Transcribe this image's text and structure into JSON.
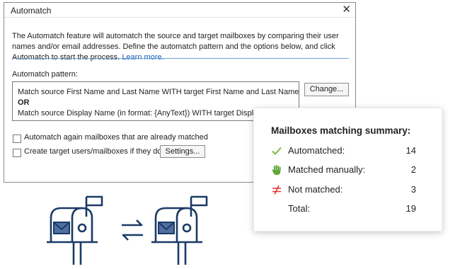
{
  "dialog": {
    "title": "Automatch",
    "close_glyph": "✕",
    "description": "The Automatch feature will automatch the source and target mailboxes by comparing their user names and/or email addresses. Define the automatch pattern and the options below, and click Automatch to start the process.",
    "learn_more": "Learn more.",
    "pattern_label": "Automatch pattern:",
    "pattern_lines": [
      "Match source First Name and Last Name WITH target First Name and Last Name",
      "OR",
      "Match source Display Name (in format: {AnyText}) WITH target Display Name (in format: {AnyText})"
    ],
    "change_button": "Change...",
    "options": [
      {
        "label": "Automatch again mailboxes that are already matched",
        "checked": false
      },
      {
        "label": "Create target users/mailboxes if they don't exist",
        "checked": false
      }
    ],
    "settings_button": "Settings..."
  },
  "summary": {
    "title": "Mailboxes matching summary:",
    "rows": [
      {
        "icon": "check-icon",
        "label": "Automatched:",
        "value": "14",
        "color": "#7dba3f"
      },
      {
        "icon": "hand-icon",
        "label": "Matched manually:",
        "value": "2",
        "color": "#5ea83a"
      },
      {
        "icon": "not-equal-icon",
        "label": "Not matched:",
        "value": "3",
        "color": "#e03a3a"
      },
      {
        "label": "Total:",
        "value": "19"
      }
    ]
  },
  "illustration": {
    "icons": [
      "mailbox-icon",
      "swap-arrows-icon",
      "mailbox-icon"
    ],
    "color": "#1b3a66",
    "envelope_color": "#4f6fa0"
  }
}
